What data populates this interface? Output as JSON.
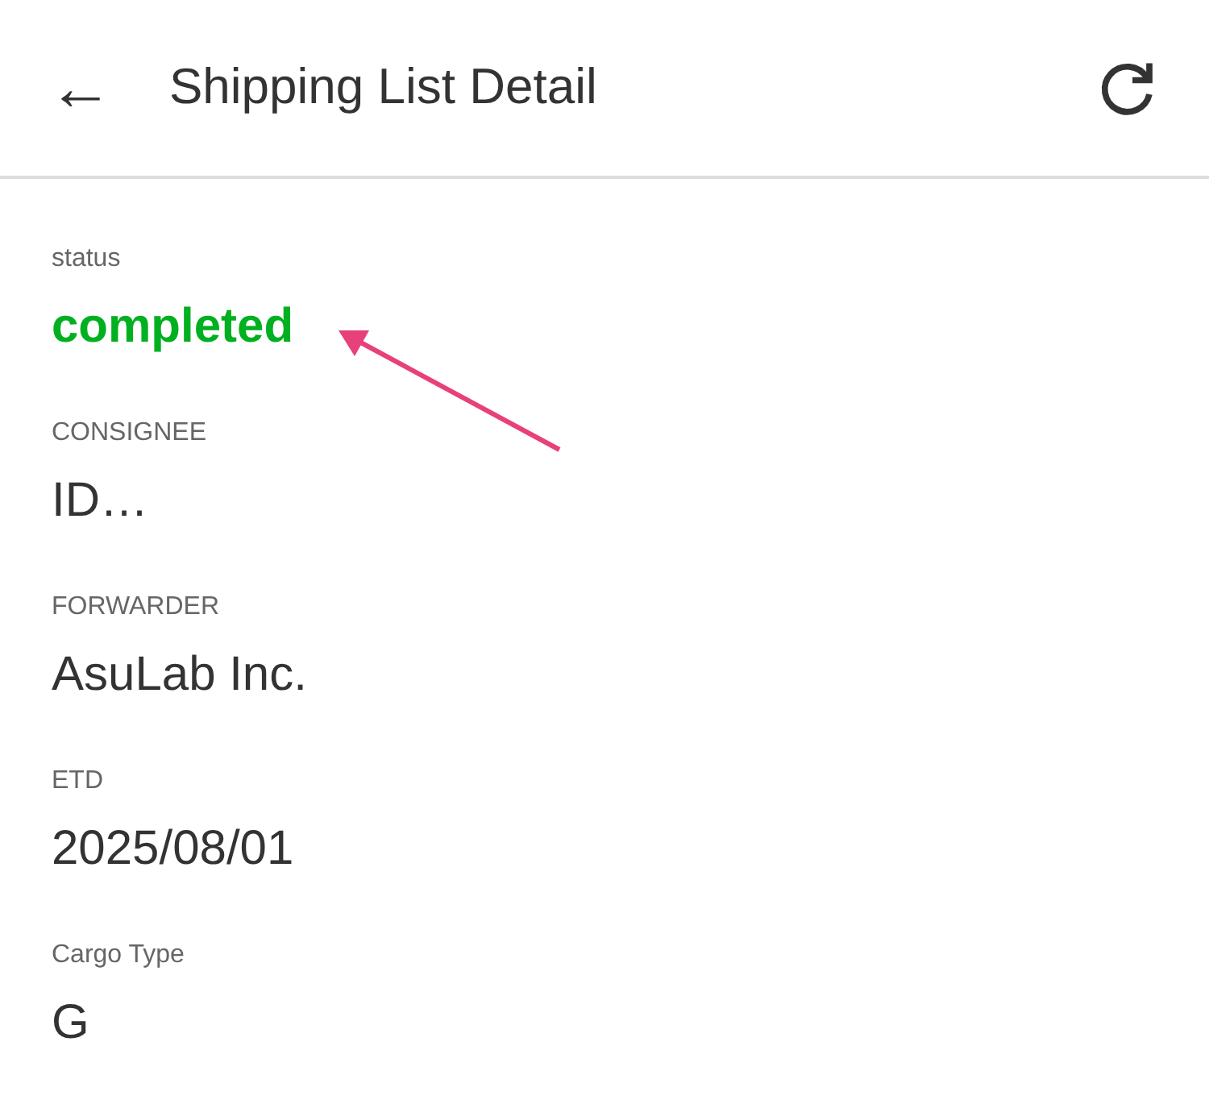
{
  "app_bar": {
    "back": "←",
    "title": "Shipping List Detail"
  },
  "fields": [
    {
      "label": "status",
      "value": "completed",
      "kind": "status"
    },
    {
      "label": "CONSIGNEE",
      "value": "ID…",
      "kind": "text"
    },
    {
      "label": "FORWARDER",
      "value": "AsuLab Inc.",
      "kind": "text"
    },
    {
      "label": "ETD",
      "value": "2025/08/01",
      "kind": "text"
    },
    {
      "label": "Cargo Type",
      "value": "G",
      "kind": "text"
    }
  ]
}
